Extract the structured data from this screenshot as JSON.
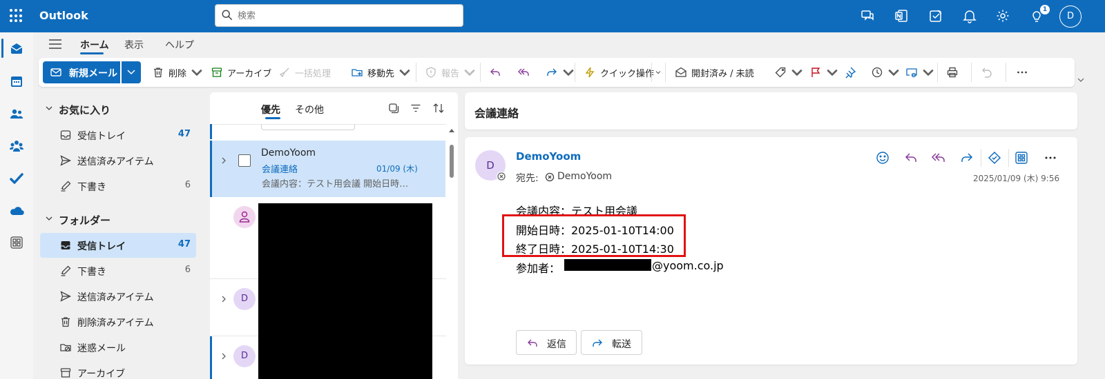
{
  "app": {
    "title": "Outlook",
    "avatar_initial": "D",
    "notification_count": "1"
  },
  "search": {
    "placeholder": "検索"
  },
  "ribbon_tabs": {
    "home": "ホーム",
    "view": "表示",
    "help": "ヘルプ"
  },
  "ribbon": {
    "new_mail": "新規メール",
    "delete": "削除",
    "archive": "アーカイブ",
    "sweep": "一括処理",
    "move_to": "移動先",
    "report": "報告",
    "quick_steps": "クイック操作",
    "read_unread": "開封済み / 未読"
  },
  "folders": {
    "favorites_header": "お気に入り",
    "favorites": [
      {
        "label": "受信トレイ",
        "count": "47",
        "icon": "inbox-icon"
      },
      {
        "label": "送信済みアイテム",
        "count": "",
        "icon": "send-icon"
      },
      {
        "label": "下書き",
        "count": "6",
        "icon": "draft-icon"
      }
    ],
    "folders_header": "フォルダー",
    "items": [
      {
        "label": "受信トレイ",
        "count": "47",
        "icon": "inbox-icon"
      },
      {
        "label": "下書き",
        "count": "6",
        "icon": "draft-icon"
      },
      {
        "label": "送信済みアイテム",
        "count": "",
        "icon": "send-icon"
      },
      {
        "label": "削除済みアイテム",
        "count": "",
        "icon": "trash-icon"
      },
      {
        "label": "迷惑メール",
        "count": "",
        "icon": "junk-icon"
      },
      {
        "label": "アーカイブ",
        "count": "",
        "icon": "archive-icon"
      }
    ]
  },
  "message_list": {
    "tab_focused": "優先",
    "tab_other": "その他",
    "selected": {
      "sender": "DemoYoom",
      "subject": "会議連絡",
      "date": "01/09 (木)",
      "preview": "会議内容：テスト用会議 開始日時…"
    },
    "other_avatars": [
      "D",
      "D"
    ]
  },
  "reading_pane": {
    "subject": "会議連絡",
    "avatar_initial": "D",
    "sender": "DemoYoom",
    "to_label": "宛先:",
    "to_name": "DemoYoom",
    "date": "2025/01/09 (木) 9:56",
    "body": {
      "line1": "会議内容：テスト用会議",
      "line2": "開始日時：2025-01-10T14:00",
      "line3": "終了日時：2025-01-10T14:30",
      "line4_label": "参加者：",
      "line4_domain": "@yoom.co.jp"
    },
    "reply": "返信",
    "forward": "転送"
  },
  "colors": {
    "brand": "#0f6cbd",
    "selection": "#cfe4fa",
    "highlight": "#e11212"
  }
}
